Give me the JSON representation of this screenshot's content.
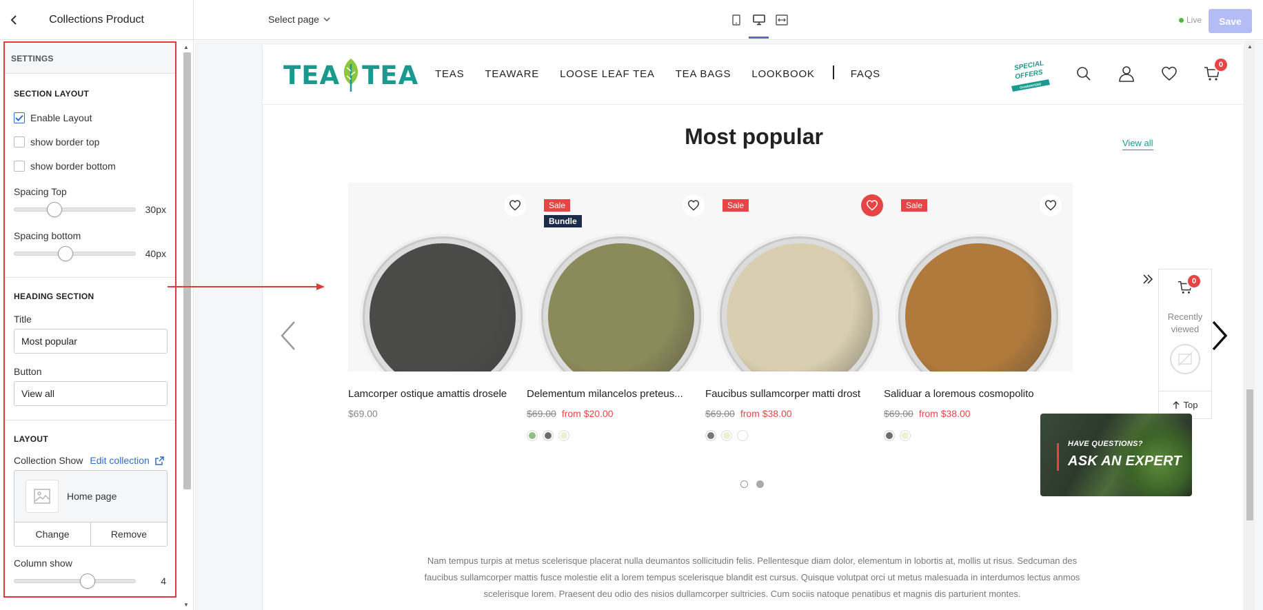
{
  "editor": {
    "title": "Collections Product",
    "settings_heading": "SETTINGS",
    "section_layout": {
      "heading": "SECTION LAYOUT",
      "enable_layout": {
        "label": "Enable Layout",
        "checked": true
      },
      "border_top": {
        "label": "show border top",
        "checked": false
      },
      "border_bottom": {
        "label": "show border bottom",
        "checked": false
      },
      "spacing_top": {
        "label": "Spacing Top",
        "value_text": "30px",
        "level": 0.3
      },
      "spacing_bottom": {
        "label": "Spacing bottom",
        "value_text": "40px",
        "level": 0.4
      }
    },
    "heading_section": {
      "heading": "HEADING SECTION",
      "title_label": "Title",
      "title_value": "Most popular",
      "button_label": "Button",
      "button_value": "View all"
    },
    "layout": {
      "heading": "LAYOUT",
      "collection_label": "Collection Show",
      "edit_link": "Edit collection",
      "collection_name": "Home page",
      "change": "Change",
      "remove": "Remove",
      "column_label": "Column show",
      "column_value": "4",
      "column_level": 0.6
    }
  },
  "toolbar": {
    "select_page": "Select page",
    "live": "Live",
    "save": "Save",
    "active_device": "desktop"
  },
  "site": {
    "logo_left": "TEA",
    "logo_right": "TEA",
    "nav": [
      "TEAS",
      "TEAWARE",
      "LOOSE LEAF TEA",
      "TEA BAGS",
      "LOOKBOOK",
      "FAQS"
    ],
    "offers_text": [
      "SPECIAL",
      "OFFERS",
      "GUARANTEED"
    ],
    "cart_count": "0"
  },
  "section": {
    "title": "Most popular",
    "view_all": "View all",
    "products": [
      {
        "name": "Lamcorper ostique amattis drosele",
        "price": "$69.00",
        "old_price": "",
        "sale_price": "",
        "sale": false,
        "bundle": false,
        "wishlisted": false,
        "tea_color": "#4a4a48",
        "swatches": []
      },
      {
        "name": "Delementum milancelos preteus...",
        "price": "",
        "old_price": "$69.00",
        "sale_price": "from $20.00",
        "sale": true,
        "bundle": true,
        "wishlisted": false,
        "tea_color": "#8b8a5a",
        "swatches": [
          "#8fbf86",
          "#6d6d6d",
          "#eef0d2"
        ]
      },
      {
        "name": "Faucibus sullamcorper matti drost",
        "price": "",
        "old_price": "$69.00",
        "sale_price": "from $38.00",
        "sale": true,
        "bundle": false,
        "wishlisted": true,
        "tea_color": "#d9cfb0",
        "swatches": [
          "#777777",
          "#eeeed0",
          "#ffffff"
        ]
      },
      {
        "name": "Saliduar a loremous cosmopolito",
        "price": "",
        "old_price": "$69.00",
        "sale_price": "from $38.00",
        "sale": true,
        "bundle": false,
        "wishlisted": false,
        "tea_color": "#b07a3c",
        "swatches": [
          "#6d6d6d",
          "#eef0d2"
        ]
      }
    ],
    "badge_sale": "Sale",
    "badge_bundle": "Bundle",
    "description": "Nam tempus turpis at metus scelerisque placerat nulla deumantos sollicitudin felis. Pellentesque diam dolor, elementum in lobortis at, mollis ut risus. Sedcuman des faucibus sullamcorper mattis fusce molestie elit a lorem tempus scelerisque blandit est cursus. Quisque volutpat orci ut metus malesuada in interdumos lectus anmos scelerisque lorem. Praesent deu odio des nisios dullamcorper sultricies. Cum sociis natoque penatibus et magnis dis parturient montes."
  },
  "widget": {
    "cart_count": "0",
    "recently_viewed": "Recently viewed",
    "top": "Top"
  },
  "expert_banner": {
    "question": "HAVE QUESTIONS?",
    "cta": "ASK AN EXPERT"
  }
}
